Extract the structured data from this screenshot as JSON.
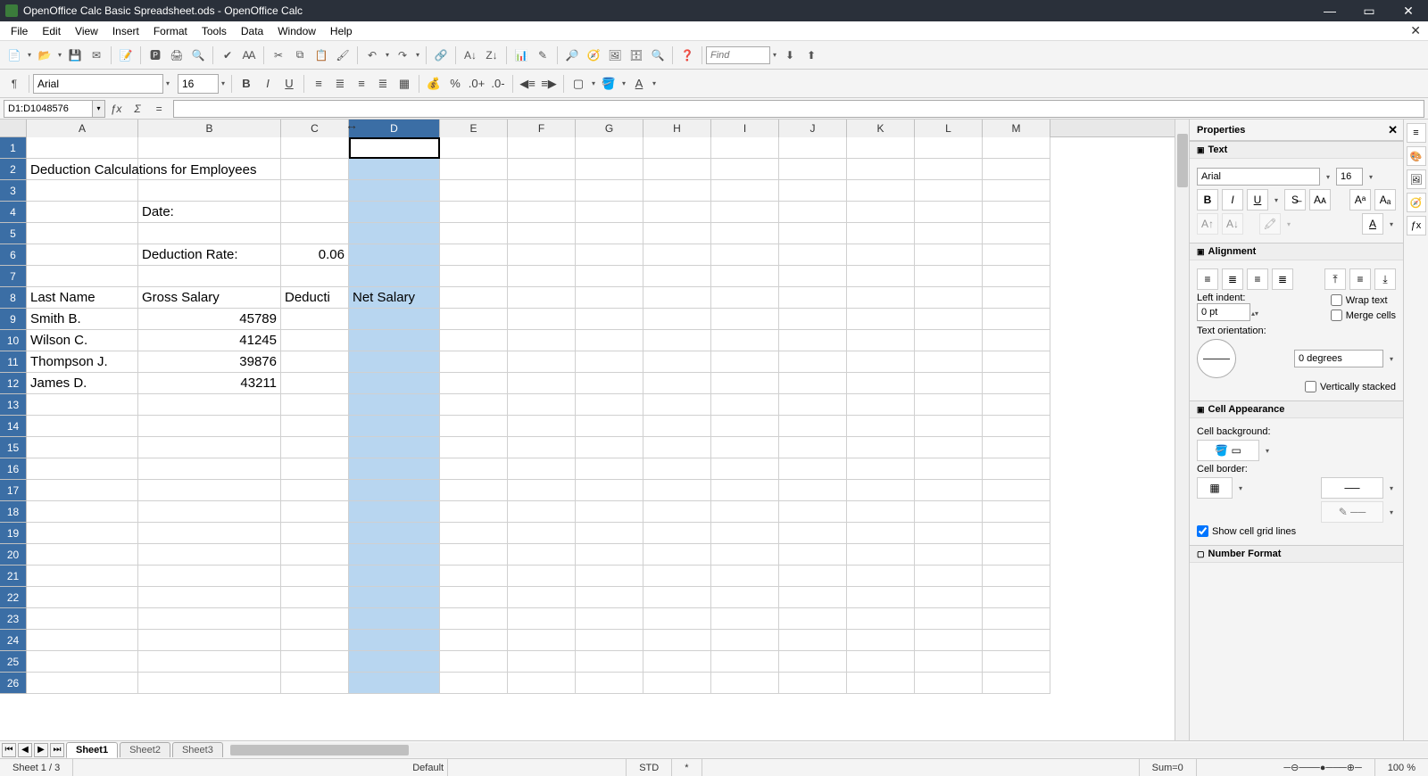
{
  "titlebar": {
    "text": "OpenOffice Calc Basic Spreadsheet.ods - OpenOffice Calc"
  },
  "menus": [
    "File",
    "Edit",
    "View",
    "Insert",
    "Format",
    "Tools",
    "Data",
    "Window",
    "Help"
  ],
  "find": {
    "placeholder": "Find"
  },
  "font": {
    "name": "Arial",
    "size": "16"
  },
  "cell_ref": "D1:D1048576",
  "formula": "",
  "columns": [
    "A",
    "B",
    "C",
    "D",
    "E",
    "F",
    "G",
    "H",
    "I",
    "J",
    "K",
    "L",
    "M"
  ],
  "selected_column_index": 3,
  "rows_visible": 26,
  "cells": {
    "A2": "Deduction Calculations for Employees",
    "B4": "Date:",
    "B6": "Deduction Rate:",
    "C6": "0.06",
    "A8": "Last Name",
    "B8": "Gross Salary",
    "C8": "Deducti",
    "D8": "Net Salary",
    "A9": "Smith B.",
    "B9": "45789",
    "A10": "Wilson C.",
    "B10": "41245",
    "A11": "Thompson J.",
    "B11": "39876",
    "A12": "James D.",
    "B12": "43211"
  },
  "sheet_tabs": [
    "Sheet1",
    "Sheet2",
    "Sheet3"
  ],
  "active_sheet": 0,
  "status": {
    "sheet": "Sheet 1 / 3",
    "style": "Default",
    "mode": "STD",
    "mark": "*",
    "sum": "Sum=0",
    "zoom": "100 %"
  },
  "sidebar": {
    "title": "Properties",
    "text_section": "Text",
    "font_name": "Arial",
    "font_size": "16",
    "alignment_section": "Alignment",
    "left_indent_label": "Left indent:",
    "left_indent_value": "0 pt",
    "wrap_text": "Wrap text",
    "merge_cells": "Merge cells",
    "orientation_label": "Text orientation:",
    "orientation_value": "0 degrees",
    "vertically_stacked": "Vertically stacked",
    "cell_appearance_section": "Cell Appearance",
    "cell_background_label": "Cell background:",
    "cell_border_label": "Cell border:",
    "show_grid_lines": "Show cell grid lines",
    "number_format_section": "Number Format"
  }
}
